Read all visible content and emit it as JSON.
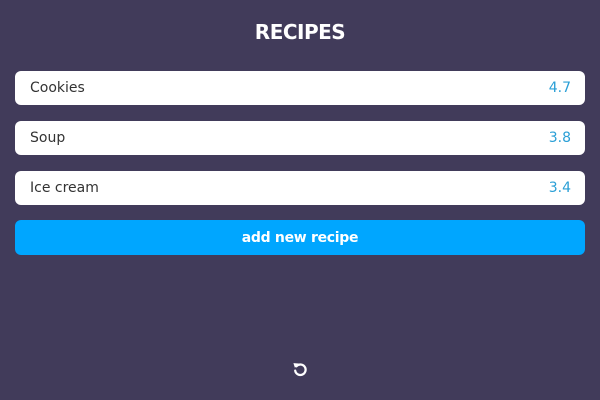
{
  "header": {
    "title": "RECIPES"
  },
  "recipes": [
    {
      "name": "Cookies",
      "rating": "4.7"
    },
    {
      "name": "Soup",
      "rating": "3.8"
    },
    {
      "name": "Ice cream",
      "rating": "3.4"
    }
  ],
  "actions": {
    "add_label": "add new recipe",
    "reset_icon": "reset-icon"
  },
  "colors": {
    "background": "#413b5a",
    "accent": "#00a6ff",
    "rating": "#2a9fd6"
  }
}
